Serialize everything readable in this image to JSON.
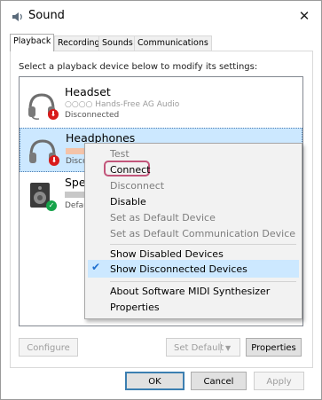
{
  "window": {
    "title": "Sound",
    "close_glyph": "✕"
  },
  "tabs": [
    {
      "label": "Playback"
    },
    {
      "label": "Recording"
    },
    {
      "label": "Sounds"
    },
    {
      "label": "Communications"
    }
  ],
  "instructions": "Select a playback device below to modify its settings:",
  "devices": [
    {
      "name": "Headset",
      "sub": "○○○○ Hands-Free AG Audio",
      "status": "Disconnected",
      "icon": "headset-icon",
      "badge": "red-down-arrow"
    },
    {
      "name": "Headphones",
      "status": "Disco",
      "icon": "headphones-icon",
      "badge": "red-down-arrow"
    },
    {
      "name": "Spea",
      "status": "Defau",
      "icon": "speaker-icon",
      "badge": "green-check"
    }
  ],
  "context_menu": {
    "items": [
      {
        "label": "Test",
        "enabled": false
      },
      {
        "label": "Connect",
        "enabled": true,
        "highlighted": true
      },
      {
        "label": "Disconnect",
        "enabled": false
      },
      {
        "label": "Disable",
        "enabled": true
      },
      {
        "label": "Set as Default Device",
        "enabled": false
      },
      {
        "label": "Set as Default Communication Device",
        "enabled": false
      },
      {
        "label": "Show Disabled Devices",
        "enabled": true
      },
      {
        "label": "Show Disconnected Devices",
        "enabled": true,
        "checked": true
      },
      {
        "label": "About Software MIDI Synthesizer",
        "enabled": true
      },
      {
        "label": "Properties",
        "enabled": true
      }
    ],
    "check_glyph": "✔"
  },
  "buttons": {
    "configure": "Configure",
    "set_default": "Set Default",
    "properties": "Properties",
    "ok": "OK",
    "cancel": "Cancel",
    "apply": "Apply"
  },
  "colors": {
    "selection": "#cce8ff",
    "highlight_ring": "#c2557a",
    "badge_red": "#d91b1b",
    "badge_green": "#16a34a"
  }
}
